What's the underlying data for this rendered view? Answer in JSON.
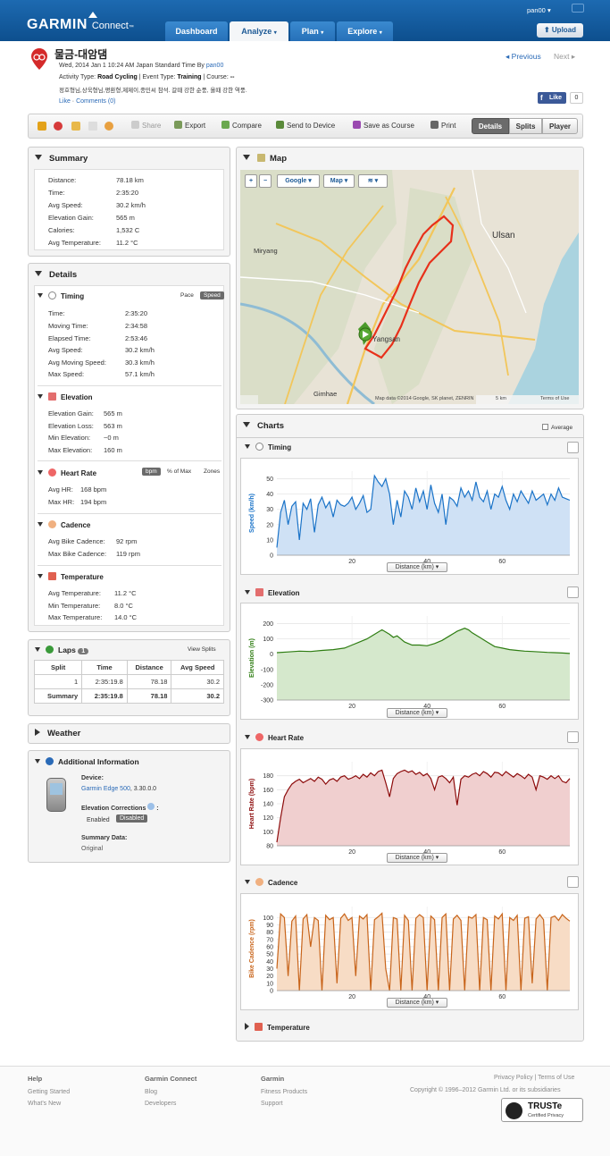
{
  "header": {
    "logo_main": "GARMIN",
    "logo_sub": "Connect",
    "logo_tm": "™",
    "user": "pan00",
    "upload": "Upload",
    "tabs": [
      {
        "label": "Dashboard"
      },
      {
        "label": "Analyze"
      },
      {
        "label": "Plan"
      },
      {
        "label": "Explore"
      }
    ]
  },
  "activity": {
    "title": "물금-대암댐",
    "date_line": "Wed, 2014 Jan 1 10:24 AM Japan Standard Time By",
    "owner": "pan00",
    "type_label": "Activity Type:",
    "type": "Road Cycling",
    "event_label": "| Event Type:",
    "event": "Training",
    "course_label": "| Course:",
    "course": "--",
    "description": "정호형님,상욱형님,평환형,제제이,종민씨 참석. 갈때 강한 순풍, 올때 강한 역풍.",
    "like": "Like",
    "sep": " · ",
    "comments": "Comments (0)",
    "prev": "Previous",
    "next": "Next",
    "fb_like": "Like",
    "fb_count": "0"
  },
  "toolbar": {
    "share": "Share",
    "export": "Export",
    "compare": "Compare",
    "send": "Send to Device",
    "save_course": "Save as Course",
    "print": "Print",
    "details": "Details",
    "splits": "Splits",
    "player": "Player"
  },
  "summary": {
    "title": "Summary",
    "rows": [
      {
        "label": "Distance:",
        "value": "78.18 km"
      },
      {
        "label": "Time:",
        "value": "2:35:20"
      },
      {
        "label": "Avg Speed:",
        "value": "30.2 km/h"
      },
      {
        "label": "Elevation Gain:",
        "value": "565 m"
      },
      {
        "label": "Calories:",
        "value": "1,532 C"
      },
      {
        "label": "Avg Temperature:",
        "value": "11.2 °C"
      }
    ]
  },
  "details": {
    "title": "Details",
    "timing": {
      "title": "Timing",
      "pace": "Pace",
      "speed": "Speed",
      "rows": [
        {
          "label": "Time:",
          "value": "2:35:20"
        },
        {
          "label": "Moving Time:",
          "value": "2:34:58"
        },
        {
          "label": "Elapsed Time:",
          "value": "2:53:46"
        },
        {
          "label": "Avg Speed:",
          "value": "30.2 km/h"
        },
        {
          "label": "Avg Moving Speed:",
          "value": "30.3 km/h"
        },
        {
          "label": "Max Speed:",
          "value": "57.1 km/h"
        }
      ]
    },
    "elevation": {
      "title": "Elevation",
      "rows": [
        {
          "label": "Elevation Gain:",
          "value": "565 m"
        },
        {
          "label": "Elevation Loss:",
          "value": "563 m"
        },
        {
          "label": "Min Elevation:",
          "value": "~0 m"
        },
        {
          "label": "Max Elevation:",
          "value": "160 m"
        }
      ]
    },
    "heart_rate": {
      "title": "Heart Rate",
      "bpm": "bpm",
      "pct": "% of Max",
      "zones": "Zones",
      "rows": [
        {
          "label": "Avg HR:",
          "value": "168 bpm"
        },
        {
          "label": "Max HR:",
          "value": "194 bpm"
        }
      ]
    },
    "cadence": {
      "title": "Cadence",
      "rows": [
        {
          "label": "Avg Bike Cadence:",
          "value": "92 rpm"
        },
        {
          "label": "Max Bike Cadence:",
          "value": "119 rpm"
        }
      ]
    },
    "temperature": {
      "title": "Temperature",
      "rows": [
        {
          "label": "Avg Temperature:",
          "value": "11.2 °C"
        },
        {
          "label": "Min Temperature:",
          "value": "8.0 °C"
        },
        {
          "label": "Max Temperature:",
          "value": "14.0 °C"
        }
      ]
    }
  },
  "laps": {
    "title": "Laps",
    "count": "1",
    "view_splits": "View Splits",
    "headers": [
      "Split",
      "Time",
      "Distance",
      "Avg Speed"
    ],
    "rows": [
      [
        "1",
        "2:35:19.8",
        "78.18",
        "30.2"
      ],
      [
        "Summary",
        "2:35:19.8",
        "78.18",
        "30.2"
      ]
    ]
  },
  "weather": {
    "title": "Weather"
  },
  "additional": {
    "title": "Additional Information",
    "device_label": "Device:",
    "device": "Garmin Edge 500",
    "device_ver": ", 3.30.0.0",
    "elev_corr": "Elevation Corrections",
    "enabled": "Enabled",
    "disabled": "Disabled",
    "summary_label": "Summary Data:",
    "summary_value": "Original"
  },
  "map": {
    "title": "Map",
    "google": "Google",
    "map": "Map",
    "zoom_in": "+",
    "zoom_out": "−",
    "attribution": "Map data ©2014 Google, SK planet, ZENRIN",
    "scale": "5 km",
    "terms": "Terms of Use",
    "places": [
      {
        "name": "Ulsan"
      },
      {
        "name": "Miryang"
      },
      {
        "name": "Yangsan"
      },
      {
        "name": "Gimhae"
      }
    ]
  },
  "charts": {
    "title": "Charts",
    "average": "Average",
    "distance_select": "Distance (km)"
  },
  "chart_data": [
    {
      "type": "area",
      "title": "Timing",
      "ylabel": "Speed (km/h)",
      "xlabel": "Distance (km)",
      "color": "#1a73c8",
      "fill": "#cfe1f5",
      "ylim": [
        0,
        55
      ],
      "xlim": [
        0,
        78
      ],
      "yticks": [
        0,
        10,
        20,
        30,
        40,
        50
      ],
      "xticks": [
        20,
        40,
        60
      ],
      "x": [
        0,
        1,
        2,
        3,
        4,
        5,
        6,
        7,
        8,
        9,
        10,
        11,
        12,
        13,
        14,
        15,
        16,
        17,
        18,
        19,
        20,
        21,
        22,
        23,
        24,
        25,
        26,
        27,
        28,
        29,
        30,
        31,
        32,
        33,
        34,
        35,
        36,
        37,
        38,
        39,
        40,
        41,
        42,
        43,
        44,
        45,
        46,
        47,
        48,
        49,
        50,
        51,
        52,
        53,
        54,
        55,
        56,
        57,
        58,
        59,
        60,
        61,
        62,
        63,
        64,
        65,
        66,
        67,
        68,
        69,
        70,
        71,
        72,
        73,
        74,
        75,
        76,
        77,
        78
      ],
      "y": [
        5,
        28,
        36,
        20,
        32,
        35,
        10,
        34,
        30,
        37,
        15,
        33,
        38,
        31,
        35,
        25,
        36,
        33,
        32,
        34,
        38,
        30,
        34,
        39,
        28,
        30,
        52,
        48,
        45,
        50,
        40,
        20,
        36,
        25,
        42,
        38,
        30,
        44,
        35,
        42,
        30,
        46,
        34,
        28,
        40,
        20,
        38,
        36,
        32,
        44,
        38,
        42,
        36,
        48,
        38,
        35,
        42,
        30,
        40,
        38,
        45,
        36,
        30,
        40,
        35,
        42,
        38,
        34,
        42,
        36,
        38,
        40,
        33,
        40,
        36,
        44,
        38,
        37,
        36
      ]
    },
    {
      "type": "area",
      "title": "Elevation",
      "ylabel": "Elevation (m)",
      "xlabel": "Distance (km)",
      "color": "#2e7d12",
      "fill": "#d5e8cc",
      "ylim": [
        -300,
        250
      ],
      "xlim": [
        0,
        78
      ],
      "yticks": [
        -300,
        -200,
        -100,
        0,
        100,
        200
      ],
      "xticks": [
        20,
        40,
        60
      ],
      "x": [
        0,
        3,
        6,
        9,
        12,
        15,
        18,
        20,
        22,
        24,
        26,
        28,
        30,
        31,
        32,
        34,
        36,
        38,
        40,
        42,
        44,
        46,
        48,
        50,
        51,
        52,
        54,
        56,
        58,
        60,
        62,
        64,
        66,
        68,
        70,
        72,
        74,
        76,
        78
      ],
      "y": [
        10,
        15,
        20,
        18,
        25,
        30,
        40,
        60,
        80,
        100,
        130,
        160,
        130,
        110,
        120,
        80,
        60,
        60,
        55,
        70,
        90,
        120,
        150,
        170,
        160,
        140,
        110,
        80,
        50,
        40,
        30,
        25,
        20,
        18,
        15,
        12,
        10,
        8,
        5
      ]
    },
    {
      "type": "area",
      "title": "Heart Rate",
      "ylabel": "Heart Rate (bpm)",
      "xlabel": "Distance (km)",
      "color": "#8c0a0a",
      "fill": "#f0cfcf",
      "ylim": [
        80,
        200
      ],
      "xlim": [
        0,
        78
      ],
      "yticks": [
        80,
        100,
        120,
        140,
        160,
        180
      ],
      "xticks": [
        20,
        40,
        60
      ],
      "x": [
        0,
        1,
        2,
        3,
        4,
        5,
        6,
        7,
        8,
        9,
        10,
        11,
        12,
        13,
        14,
        15,
        16,
        17,
        18,
        19,
        20,
        21,
        22,
        23,
        24,
        25,
        26,
        27,
        28,
        29,
        30,
        31,
        32,
        33,
        34,
        35,
        36,
        37,
        38,
        39,
        40,
        41,
        42,
        43,
        44,
        45,
        46,
        47,
        48,
        49,
        50,
        51,
        52,
        53,
        54,
        55,
        56,
        57,
        58,
        59,
        60,
        61,
        62,
        63,
        64,
        65,
        66,
        67,
        68,
        69,
        70,
        71,
        72,
        73,
        74,
        75,
        76,
        77,
        78
      ],
      "y": [
        85,
        120,
        150,
        160,
        168,
        172,
        175,
        170,
        173,
        176,
        172,
        178,
        175,
        168,
        174,
        176,
        172,
        178,
        180,
        175,
        177,
        180,
        176,
        182,
        178,
        184,
        180,
        186,
        188,
        170,
        150,
        176,
        183,
        186,
        188,
        185,
        187,
        182,
        185,
        180,
        183,
        176,
        160,
        178,
        180,
        176,
        170,
        178,
        138,
        175,
        180,
        178,
        182,
        184,
        180,
        186,
        183,
        178,
        185,
        184,
        180,
        186,
        182,
        178,
        183,
        180,
        176,
        182,
        178,
        160,
        180,
        178,
        175,
        180,
        176,
        180,
        172,
        170,
        176
      ]
    },
    {
      "type": "area",
      "title": "Cadence",
      "ylabel": "Bike Cadence (rpm)",
      "xlabel": "Distance (km)",
      "color": "#c8641a",
      "fill": "#f7dcc5",
      "ylim": [
        0,
        115
      ],
      "xlim": [
        0,
        78
      ],
      "yticks": [
        0,
        10,
        20,
        30,
        40,
        50,
        60,
        70,
        80,
        90,
        100
      ],
      "xticks": [
        20,
        40,
        60
      ],
      "x": [
        0,
        1,
        2,
        3,
        4,
        5,
        6,
        7,
        8,
        9,
        10,
        11,
        12,
        13,
        14,
        15,
        16,
        17,
        18,
        19,
        20,
        21,
        22,
        23,
        24,
        25,
        26,
        27,
        28,
        29,
        30,
        31,
        32,
        33,
        34,
        35,
        36,
        37,
        38,
        39,
        40,
        41,
        42,
        43,
        44,
        45,
        46,
        47,
        48,
        49,
        50,
        51,
        52,
        53,
        54,
        55,
        56,
        57,
        58,
        59,
        60,
        61,
        62,
        63,
        64,
        65,
        66,
        67,
        68,
        69,
        70,
        71,
        72,
        73,
        74,
        75,
        76,
        77,
        78
      ],
      "y": [
        30,
        105,
        100,
        20,
        95,
        102,
        0,
        98,
        104,
        60,
        100,
        96,
        0,
        103,
        97,
        100,
        10,
        99,
        105,
        96,
        100,
        20,
        102,
        98,
        104,
        0,
        97,
        101,
        106,
        30,
        0,
        100,
        98,
        0,
        103,
        96,
        0,
        99,
        104,
        100,
        0,
        102,
        97,
        0,
        100,
        105,
        0,
        98,
        103,
        96,
        0,
        101,
        99,
        104,
        0,
        100,
        97,
        0,
        102,
        98,
        105,
        0,
        100,
        96,
        103,
        0,
        99,
        101,
        10,
        98,
        104,
        97,
        0,
        100,
        102,
        96,
        104,
        99,
        95
      ]
    },
    {
      "type": "area",
      "title": "Temperature"
    }
  ],
  "footer": {
    "help": "Help",
    "getting_started": "Getting Started",
    "whats_new": "What's New",
    "gc": "Garmin Connect",
    "blog": "Blog",
    "developers": "Developers",
    "garmin": "Garmin",
    "fitness": "Fitness Products",
    "support": "Support",
    "privacy": "Privacy Policy | Terms of Use",
    "copyright": "Copyright © 1996–2012 Garmin Ltd. or its subsidiaries",
    "truste": "TRUSTe",
    "truste_sub": "Certified Privacy"
  }
}
